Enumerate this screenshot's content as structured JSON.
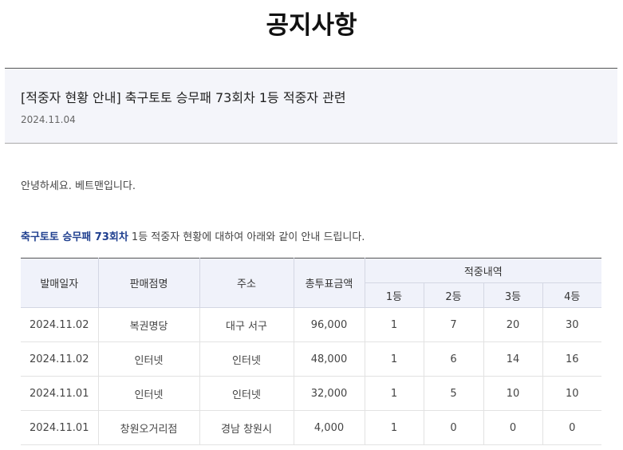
{
  "page": {
    "title": "공지사항"
  },
  "notice": {
    "title": "[적중자 현황 안내] 축구토토 승무패 73회차 1등 적중자 관련",
    "date": "2024.11.04"
  },
  "body": {
    "greeting": "안녕하세요. 베트맨입니다.",
    "intro_highlight": "축구토토 승무패 73회차",
    "intro_rest": " 1등 적중자 현황에 대하여 아래와 같이 안내 드립니다."
  },
  "table": {
    "headers": {
      "date": "발매일자",
      "store": "판매점명",
      "address": "주소",
      "total": "총투표금액",
      "hits": "적중내역",
      "rank1": "1등",
      "rank2": "2등",
      "rank3": "3등",
      "rank4": "4등"
    },
    "rows": [
      {
        "date": "2024.11.02",
        "store": "복권명당",
        "address": "대구 서구",
        "total": "96,000",
        "r1": "1",
        "r2": "7",
        "r3": "20",
        "r4": "30"
      },
      {
        "date": "2024.11.02",
        "store": "인터넷",
        "address": "인터넷",
        "total": "48,000",
        "r1": "1",
        "r2": "6",
        "r3": "14",
        "r4": "16"
      },
      {
        "date": "2024.11.01",
        "store": "인터넷",
        "address": "인터넷",
        "total": "32,000",
        "r1": "1",
        "r2": "5",
        "r3": "10",
        "r4": "10"
      },
      {
        "date": "2024.11.01",
        "store": "창원오거리점",
        "address": "경남 창원시",
        "total": "4,000",
        "r1": "1",
        "r2": "0",
        "r3": "0",
        "r4": "0"
      }
    ]
  },
  "colors": {
    "highlight": "#1f3f8f",
    "header_bg": "#f4f5fa"
  }
}
